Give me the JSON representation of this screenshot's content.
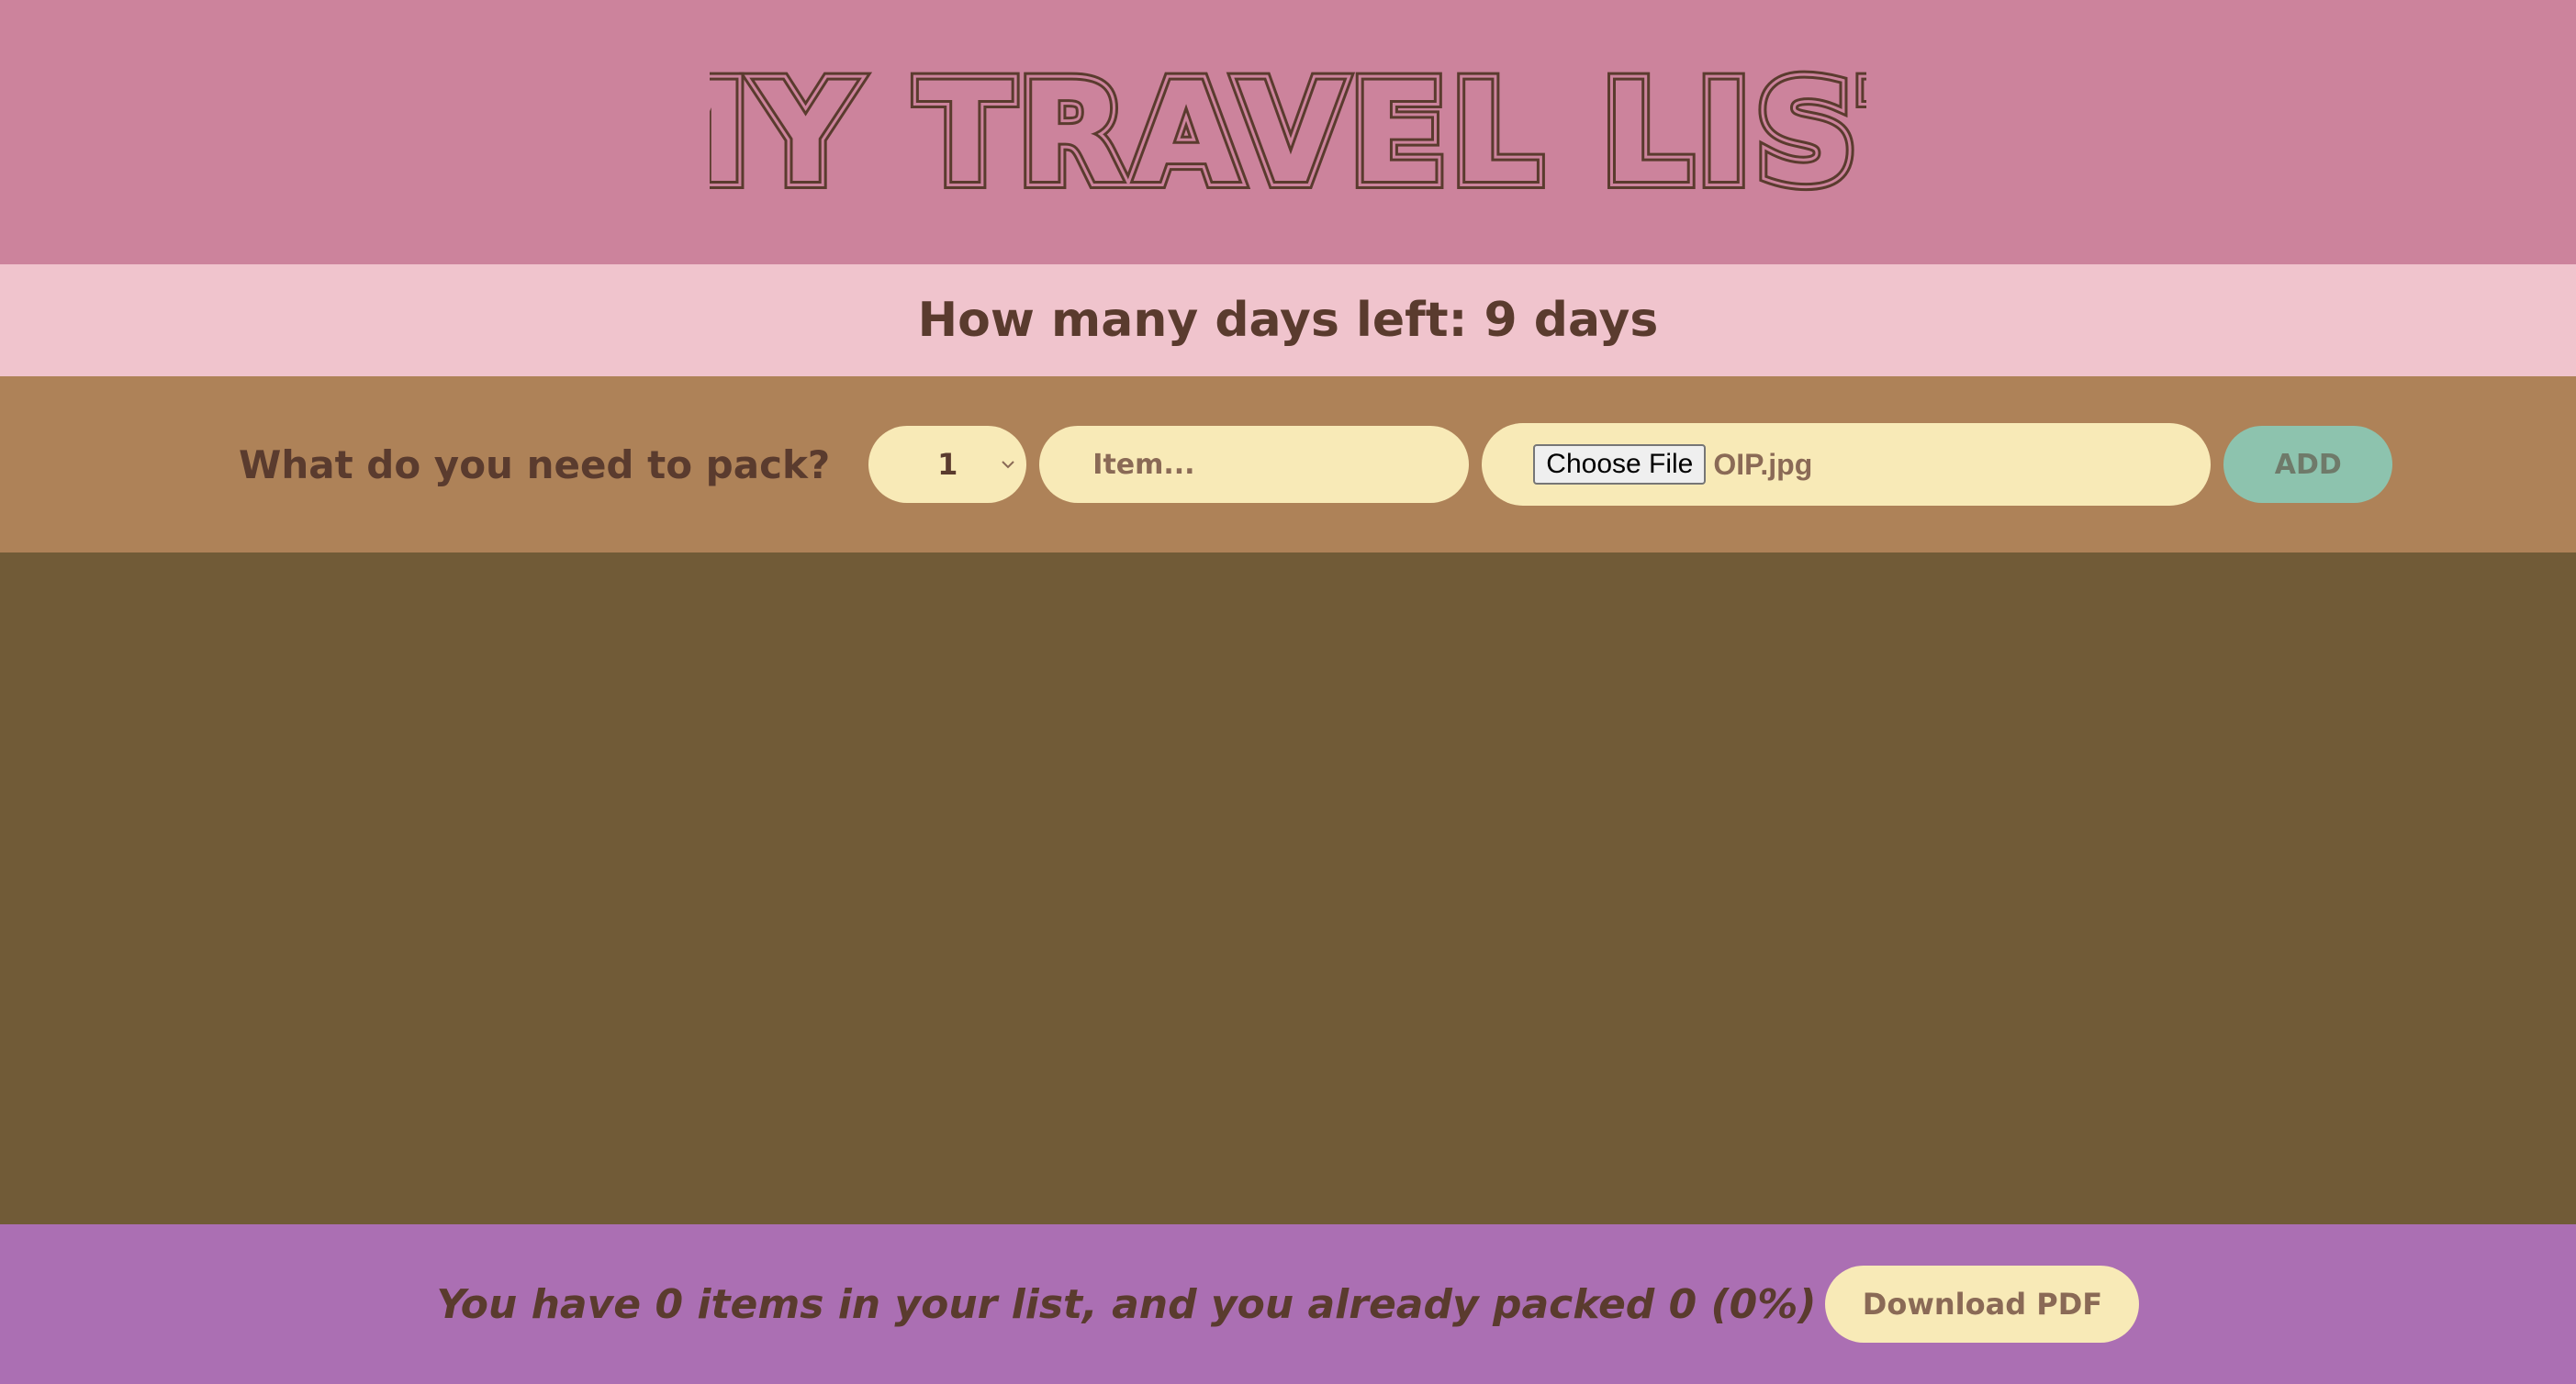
{
  "header": {
    "title": "MY TRAVEL LIST"
  },
  "countdown": {
    "text": "How many days left: 9 days"
  },
  "add_form": {
    "prompt": "What do you need to pack?",
    "quantity_selected": "1",
    "item_placeholder": "Item...",
    "file_button_label": "Choose File",
    "file_name": "OIP.jpg",
    "add_label": "ADD"
  },
  "stats": {
    "text": "You have 0 items in your list, and you already packed 0 (0%)",
    "download_label": "Download PDF"
  },
  "colors": {
    "header_bg": "#cc839c",
    "countdown_bg": "#f0c4cd",
    "form_bg": "#ae8258",
    "list_bg": "#715b37",
    "stats_bg": "#ab6fb3",
    "text_dark": "#5a3b2e",
    "input_bg": "#f8eab7",
    "add_button_bg": "#8dc3ae"
  },
  "icons": {
    "select_chevron": "chevron-down-icon"
  }
}
